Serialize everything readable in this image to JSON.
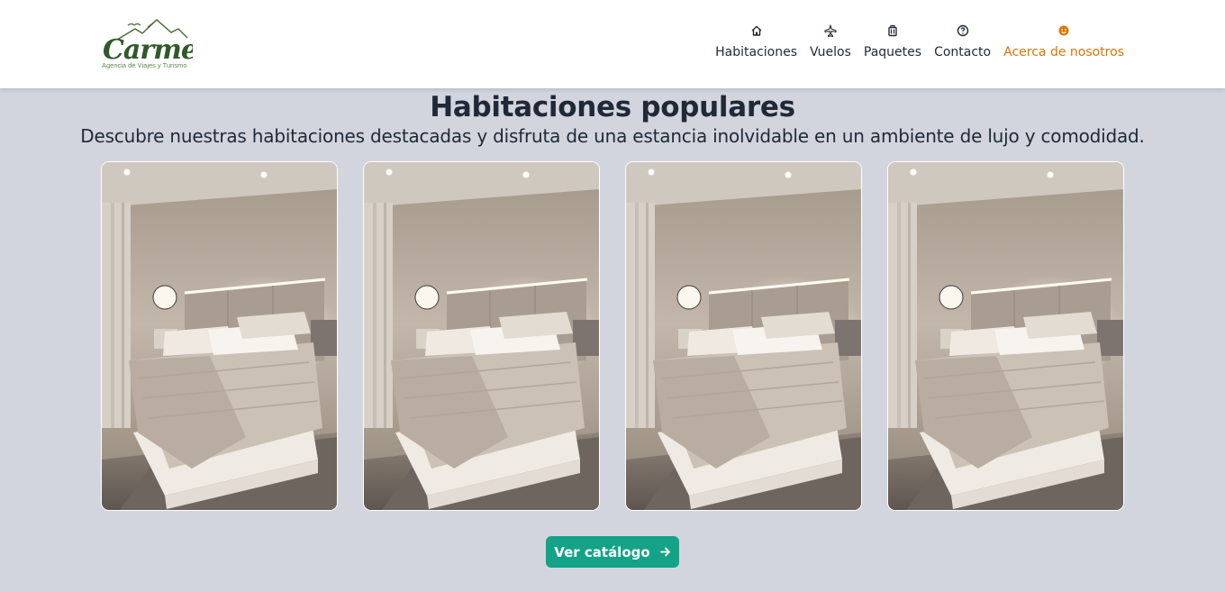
{
  "brand": {
    "logo_text": "Carmen",
    "logo_tagline": "Agencia de Viajes y Turismo"
  },
  "nav": {
    "items": [
      {
        "label": "Habitaciones",
        "icon": "home-icon"
      },
      {
        "label": "Vuelos",
        "icon": "plane-icon"
      },
      {
        "label": "Paquetes",
        "icon": "luggage-icon"
      },
      {
        "label": "Contacto",
        "icon": "help-circle-icon"
      },
      {
        "label": "Acerca de nosotros",
        "icon": "smile-icon",
        "active": true
      }
    ],
    "active_color": "#d97706"
  },
  "section": {
    "title": "Habitaciones populares",
    "subtitle": "Descubre nuestras habitaciones destacadas y disfruta de una estancia inolvidable en un ambiente de lujo y comodidad."
  },
  "cards": [
    {
      "image": "bedroom-photo"
    },
    {
      "image": "bedroom-photo"
    },
    {
      "image": "bedroom-photo"
    },
    {
      "image": "bedroom-photo"
    }
  ],
  "cta": {
    "label": "Ver catálogo",
    "icon": "arrow-right-icon",
    "color": "#14a386"
  }
}
